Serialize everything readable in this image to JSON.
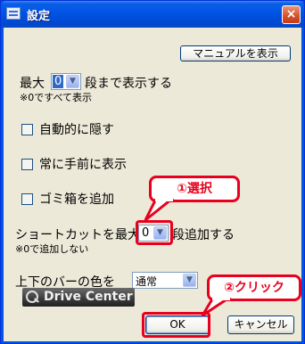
{
  "window": {
    "title": "設定",
    "close_glyph": "×"
  },
  "toolbar": {
    "manual_label": "マニュアルを表示"
  },
  "max_rows": {
    "prefix": "最大",
    "value": "0",
    "suffix": "段まで表示する",
    "note": "※0ですべて表示"
  },
  "checkboxes": [
    {
      "label": "自動的に隠す",
      "checked": false
    },
    {
      "label": "常に手前に表示",
      "checked": false
    },
    {
      "label": "ゴミ箱を追加",
      "checked": false
    }
  ],
  "shortcut": {
    "prefix": "ショートカットを最大",
    "value": "0",
    "suffix": "段追加する",
    "note": "※0で追加しない"
  },
  "bar_color": {
    "label": "上下のバーの色を",
    "value": "通常"
  },
  "logo": {
    "text": "Drive Center"
  },
  "buttons": {
    "ok": "OK",
    "cancel": "キャンセル"
  },
  "annotations": {
    "step1": "①選択",
    "step2": "②クリック",
    "color": "#e8001e"
  },
  "icons": {
    "dropdown": "chevron-down-icon",
    "app": "settings-window-icon",
    "logo": "magnifier-icon"
  }
}
